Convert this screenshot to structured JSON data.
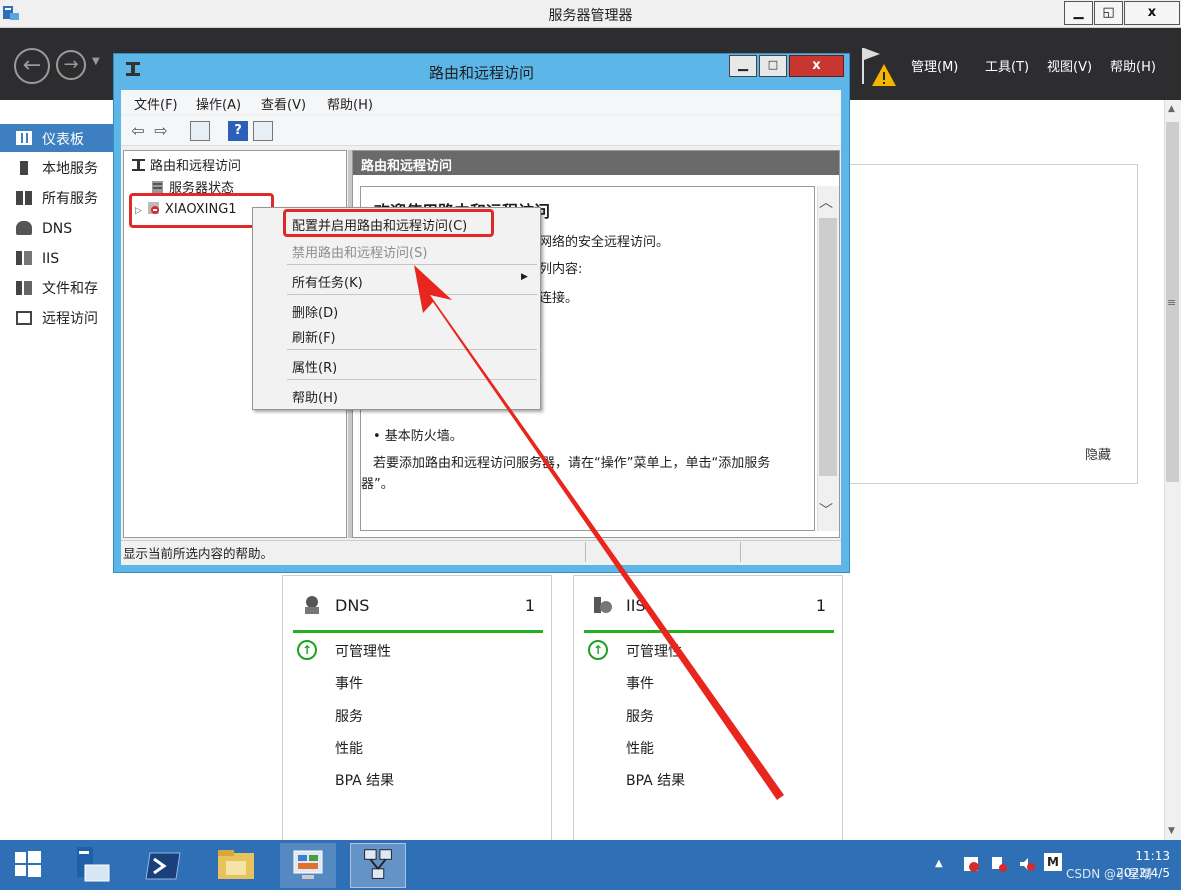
{
  "server_manager": {
    "title": "服务器管理器",
    "menu": {
      "manage": "管理(M)",
      "tools": "工具(T)",
      "view": "视图(V)",
      "help": "帮助(H)"
    },
    "nav": {
      "dashboard": "仪表板",
      "local_server": "本地服务",
      "all_servers": "所有服务",
      "dns": "DNS",
      "iis": "IIS",
      "file_storage": "文件和存",
      "remote_access": "远程访问"
    },
    "hide_label": "隐藏",
    "tiles": [
      {
        "name": "DNS",
        "count": "1",
        "rows": [
          "可管理性",
          "事件",
          "服务",
          "性能",
          "BPA 结果"
        ]
      },
      {
        "name": "IIS",
        "count": "1",
        "rows": [
          "可管理性",
          "事件",
          "服务",
          "性能",
          "BPA 结果"
        ]
      }
    ]
  },
  "rras": {
    "title": "路由和远程访问",
    "menu": {
      "file": "文件(F)",
      "action": "操作(A)",
      "view": "查看(V)",
      "help": "帮助(H)"
    },
    "tree": {
      "root": "路由和远程访问",
      "server_status": "服务器状态",
      "server": "XIAOXING1"
    },
    "detail": {
      "header": "路由和远程访问",
      "welcome": "欢迎使用路由和远程访问",
      "line1": "网络的安全远程访问。",
      "line2": "列内容:",
      "line3": "连接。",
      "firewall": "• 基本防火墙。",
      "add_line1": "若要添加路由和远程访问服务器，请在“操作”菜单上，单击“添加服务",
      "add_line2": "器”。"
    },
    "status": "显示当前所选内容的帮助。"
  },
  "context_menu": {
    "configure": "配置并启用路由和远程访问(C)",
    "disable": "禁用路由和远程访问(S)",
    "all_tasks": "所有任务(K)",
    "delete": "删除(D)",
    "refresh": "刷新(F)",
    "properties": "属性(R)",
    "help": "帮助(H)"
  },
  "taskbar": {
    "time": "11:13",
    "date": "2022/4/5"
  },
  "watermark": "CSDN @小星晴",
  "colors": {
    "accent_red": "#e02a2a",
    "title_blue": "#5cb6e8",
    "header_dark": "#2d2d30",
    "nav_selected": "#3d7fc1",
    "taskbar": "#2f6fb5",
    "ok_green": "#20b020"
  }
}
